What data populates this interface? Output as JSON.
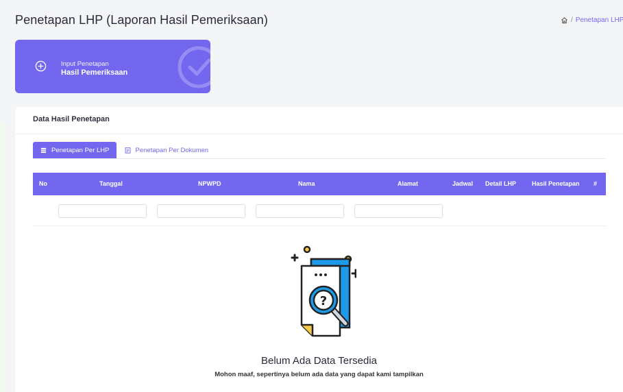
{
  "header": {
    "title": "Penetapan LHP (Laporan Hasil Pemeriksaan)",
    "breadcrumb": {
      "separator": "/",
      "current": "Penetapan LHP"
    }
  },
  "action_card": {
    "line1": "Input Penetapan",
    "line2": "Hasil Pemeriksaan",
    "icon": "plus-circle-icon",
    "background_icon": "check-circle-icon",
    "color": "#7367f0"
  },
  "panel": {
    "title": "Data Hasil Penetapan",
    "tabs": [
      {
        "label": "Penetapan Per LHP",
        "active": true,
        "icon": "list-icon"
      },
      {
        "label": "Penetapan Per Dokumen",
        "active": false,
        "icon": "document-icon"
      }
    ],
    "table": {
      "columns": [
        "No",
        "Tanggal",
        "NPWPD",
        "Nama",
        "Alamat",
        "Jadwal",
        "Detail LHP",
        "Hasil Penetapan",
        "#"
      ],
      "filters": [
        {
          "value": "",
          "placeholder": ""
        },
        {
          "value": "",
          "placeholder": ""
        },
        {
          "value": "",
          "placeholder": ""
        },
        {
          "value": "",
          "placeholder": ""
        }
      ],
      "rows": []
    },
    "empty_state": {
      "title": "Belum Ada Data Tersedia",
      "subtitle": "Mohon maaf, sepertinya belum ada data yang dapat kami tampilkan",
      "illustration": "document-search-icon"
    }
  },
  "colors": {
    "accent": "#7367f0",
    "illustration_blue": "#1e9be8",
    "illustration_yellow": "#f7c948",
    "illustration_dark": "#222222"
  }
}
